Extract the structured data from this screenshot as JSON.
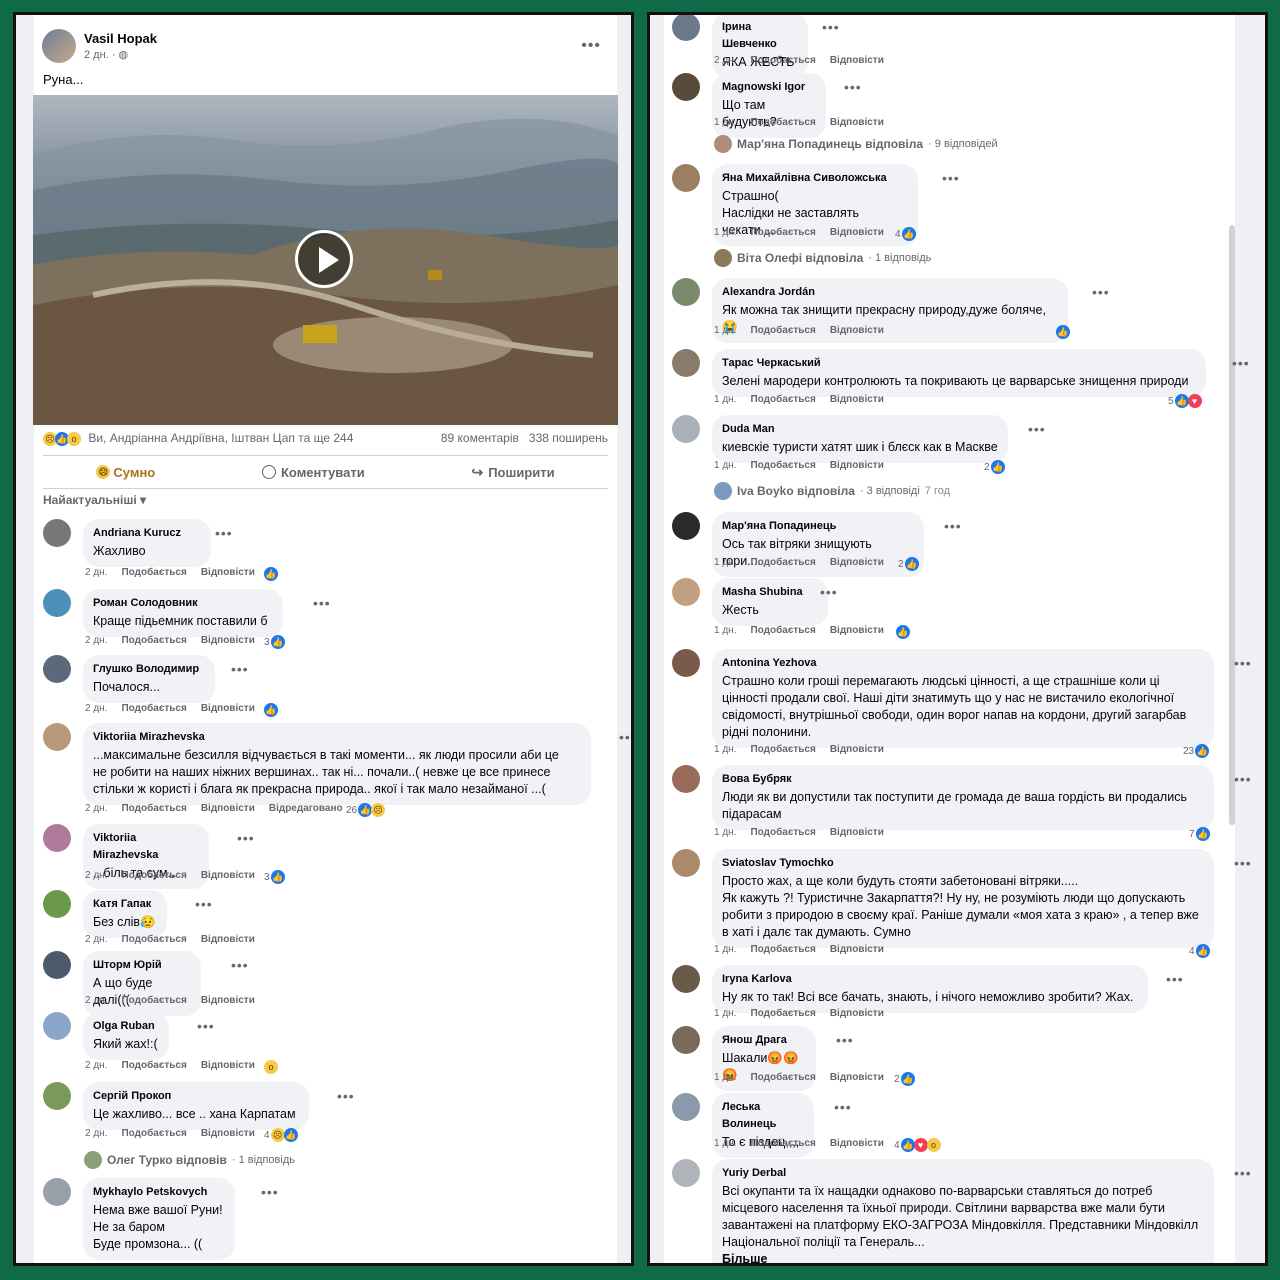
{
  "post": {
    "author": "Vasil Hopak",
    "time": "2 дн. ·",
    "text": "Руна...",
    "reactions_names": "Ви, Андріанна Андріївна, Іштван Цап та ще 244",
    "comments_count": "89 коментарів",
    "shares_count": "338 поширень",
    "actions": {
      "react": "Сумно",
      "comment": "Коментувати",
      "share": "Поширити"
    },
    "sort_label": "Найактуальніші"
  },
  "labels": {
    "like": "Подобається",
    "reply": "Відповісти",
    "edited": "Відредаговано"
  },
  "left_comments": [
    {
      "name": "Andriana Kurucz",
      "text": "Жахливо",
      "age": "2 дн.",
      "count": ""
    },
    {
      "name": "Роман Солодовник",
      "text": "Краще підьемник поставили б",
      "age": "2 дн.",
      "count": "3"
    },
    {
      "name": "Глушко Володимир",
      "text": "Почалося...",
      "age": "2 дн.",
      "count": ""
    },
    {
      "name": "Viktoriia Mirazhevska",
      "text": "...максимальне безсилля відчувається в такі моменти... як люди просили аби це\nне робити на наших ніжних вершинах.. так ні... почали..( невже це все принесе\nстільки ж користі і блага як прекрасна природа.. якої і так мало незайманої ...(",
      "age": "2 дн.",
      "count": "26"
    },
    {
      "name": "Viktoriia Mirazhevska",
      "text": ".. біль та сум...",
      "age": "2 дн.",
      "count": "3"
    },
    {
      "name": "Катя Гапак",
      "text": "Без слів😥",
      "age": "2 дн.",
      "count": ""
    },
    {
      "name": "Шторм Юрій",
      "text": "А що буде далі(((",
      "age": "2 дн.",
      "count": ""
    },
    {
      "name": "Olga Ruban",
      "text": "Який жах!:(",
      "age": "2 дн.",
      "count": ""
    },
    {
      "name": "Сергій Прокоп",
      "text": "Це жахливо... все .. хана Карпатам",
      "age": "2 дн.",
      "count": "4"
    },
    {
      "name": "Mykhaylo Petskovych",
      "text": "Нема вже вашої Руни!\nНе за баром\nБуде промзона... ((",
      "age": "",
      "count": ""
    }
  ],
  "left_reply_link": {
    "text": "Олег Турко відповів",
    "sub": "· 1 відповідь"
  },
  "right_comments": [
    {
      "name": "Ірина Шевченко",
      "text": "ЯКА ЖЕСТЬ",
      "age": "2 дн.",
      "count": ""
    },
    {
      "name": "Magnowski Igor",
      "text": "Що там будують?",
      "age": "1 дн.",
      "count": ""
    },
    {
      "name": "Яна Михайлівна Сиволожська",
      "text": "Страшно(\nНаслідки не заставлять чекати....",
      "age": "1 дн.",
      "count": "4"
    },
    {
      "name": "Alexandra Jordán",
      "text": "Як можна так знищити прекрасну природу,дуже боляче,😭",
      "age": "1 дн.",
      "count": ""
    },
    {
      "name": "Тарас Черкаський",
      "text": "Зелені мародери контролюють та покривають це варварське знищення природи",
      "age": "1 дн.",
      "count": "5"
    },
    {
      "name": "Duda Man",
      "text": "киевскіе туристи хатят шик і блєск как в Маскве",
      "age": "1 дн.",
      "count": "2"
    },
    {
      "name": "Мар'яна Попадинець",
      "text": "Ось так вітряки знищують гори....",
      "age": "1 дн.",
      "count": "2"
    },
    {
      "name": "Masha Shubina",
      "text": "Жесть",
      "age": "1 дн.",
      "count": ""
    },
    {
      "name": "Antonina Yezhova",
      "text": "Страшно коли гроші перемагають людські цінності, а ще страшніше коли ці\nцінності продали свої. Наші діти знатимуть що у нас не вистачило екологічної\nсвідомості, внутрішньої свободи, один ворог напав на кордони, другий загарбав\nрідні полонини.",
      "age": "1 дн.",
      "count": "23"
    },
    {
      "name": "Вова Бубряк",
      "text": "Люди як ви допустили так поступити де громада де ваша гордість ви продались\nпідарасам",
      "age": "1 дн.",
      "count": "7"
    },
    {
      "name": "Sviatoslav Tymochko",
      "text": "Просто жах, а ще коли будуть стояти забетоновані вітряки.....\nЯк кажуть ?! Туристичне Закарпаття?! Ну ну, не розуміють люди що допускають\nробити з природою в своєму краї. Раніше думали «моя хата з краю» , а тепер вже\nв хаті і далє так думають. Сумно",
      "age": "1 дн.",
      "count": "4"
    },
    {
      "name": "Iryna Karlova",
      "text": "Ну як то так! Всі все бачать, знають, і нічого неможливо зробити? Жах.",
      "age": "1 дн.",
      "count": ""
    },
    {
      "name": "Янош Драга",
      "text": "Шакали😡😡😡",
      "age": "1 дн.",
      "count": "2"
    },
    {
      "name": "Леська Волинець",
      "text": "То є піздец,,,,",
      "age": "1 дн.",
      "count": "4"
    },
    {
      "name": "Yuriy Derbal",
      "text": "Всі окупанти та їх нащадки однаково по-варварськи ставляться до потреб\nмісцевого населення та їхньої природи. Світлини варварства вже мали бути\nзавантажені на платформу ЕКО-ЗАГРОЗА Міндовкілля. Представники Міндовкілл\nНаціональної поліції та Генераль...",
      "more": "Більше",
      "age": "",
      "count": ""
    }
  ],
  "right_reply_links": [
    {
      "text": "Мар'яна Попадинець відповіла",
      "sub": "· 9 відповідей"
    },
    {
      "text": "Віта Олефі відповіла",
      "sub": "· 1 відповідь"
    },
    {
      "text": "Iva Boyko відповіла",
      "sub": "· 3 відповіді",
      "extra": "7 год"
    }
  ],
  "colors": {
    "background": "#0f6b47",
    "bubble": "#f0f2f5",
    "like": "#1877f2"
  }
}
